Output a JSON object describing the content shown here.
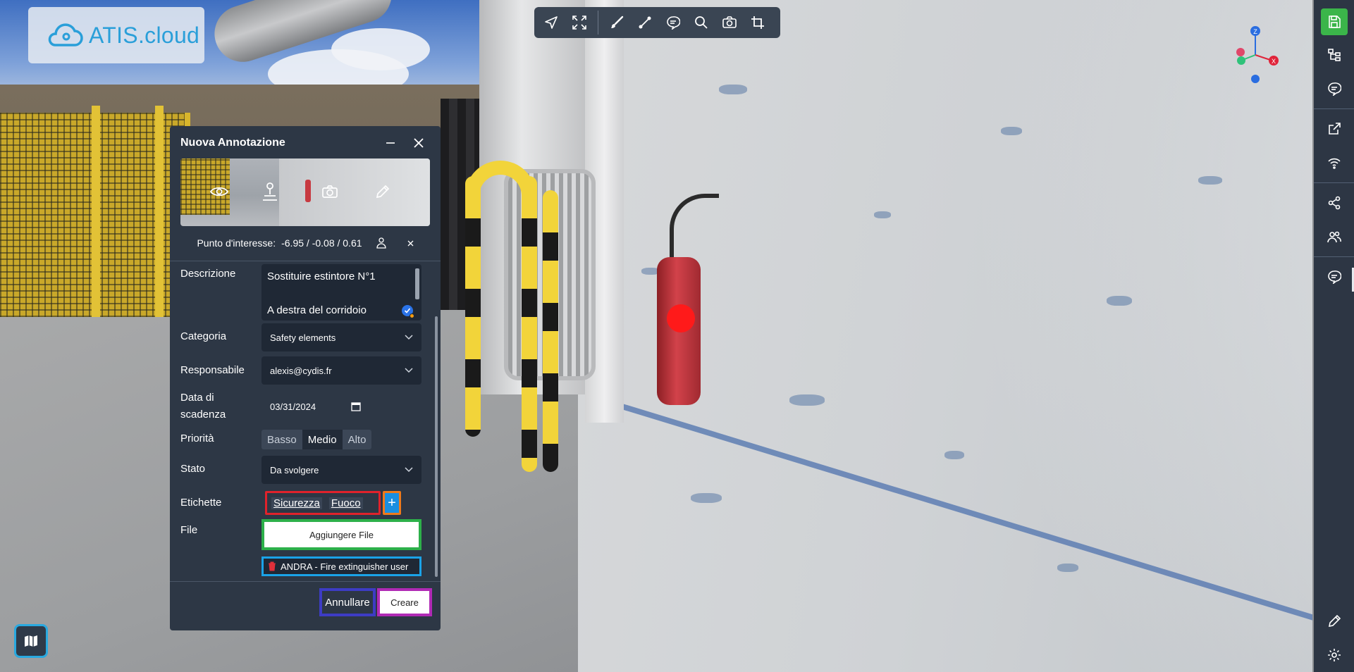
{
  "app": {
    "logo_text": "ATIS.cloud"
  },
  "toolbar": {
    "items": [
      "navigate-icon",
      "fullscreen-icon",
      "brush-icon",
      "measure-icon",
      "comment-icon",
      "search-icon",
      "camera-icon",
      "crop-icon"
    ]
  },
  "sidebar": {
    "top_items": [
      "save-icon",
      "tree-icon",
      "comment-icon",
      "external-link-icon",
      "wifi-icon",
      "share-icon",
      "users-icon",
      "annotations-icon"
    ],
    "bottom_items": [
      "pencil-icon",
      "gear-icon"
    ],
    "accent_color": "#3bb54a"
  },
  "annotation": {
    "title": "Nuova Annotazione",
    "poi_label": "Punto d'interesse:",
    "poi_value": "-6.95 / -0.08 / 0.61",
    "labels": {
      "description": "Descrizione",
      "category": "Categoria",
      "responsible": "Responsabile",
      "due_date_line1": "Data di",
      "due_date_line2": "scadenza",
      "priority": "Priorità",
      "status": "Stato",
      "tags": "Etichette",
      "file": "File"
    },
    "description_line1": "Sostituire estintore N°1",
    "description_line2": "A destra del corridoio",
    "category": "Safety elements",
    "responsible": "alexis@cydis.fr",
    "due_date": "03/31/2024",
    "priority_options": [
      "Basso",
      "Medio",
      "Alto"
    ],
    "priority_selected": "Medio",
    "status": "Da svolgere",
    "tags": [
      "Sicurezza",
      "Fuoco"
    ],
    "tag_add": "+",
    "add_file_label": "Aggiungere File",
    "file_name": "ANDRA - Fire extinguisher user",
    "cancel_label": "Annullare",
    "create_label": "Creare"
  },
  "gizmo": {
    "z_label": "Z",
    "x_label": "X"
  }
}
